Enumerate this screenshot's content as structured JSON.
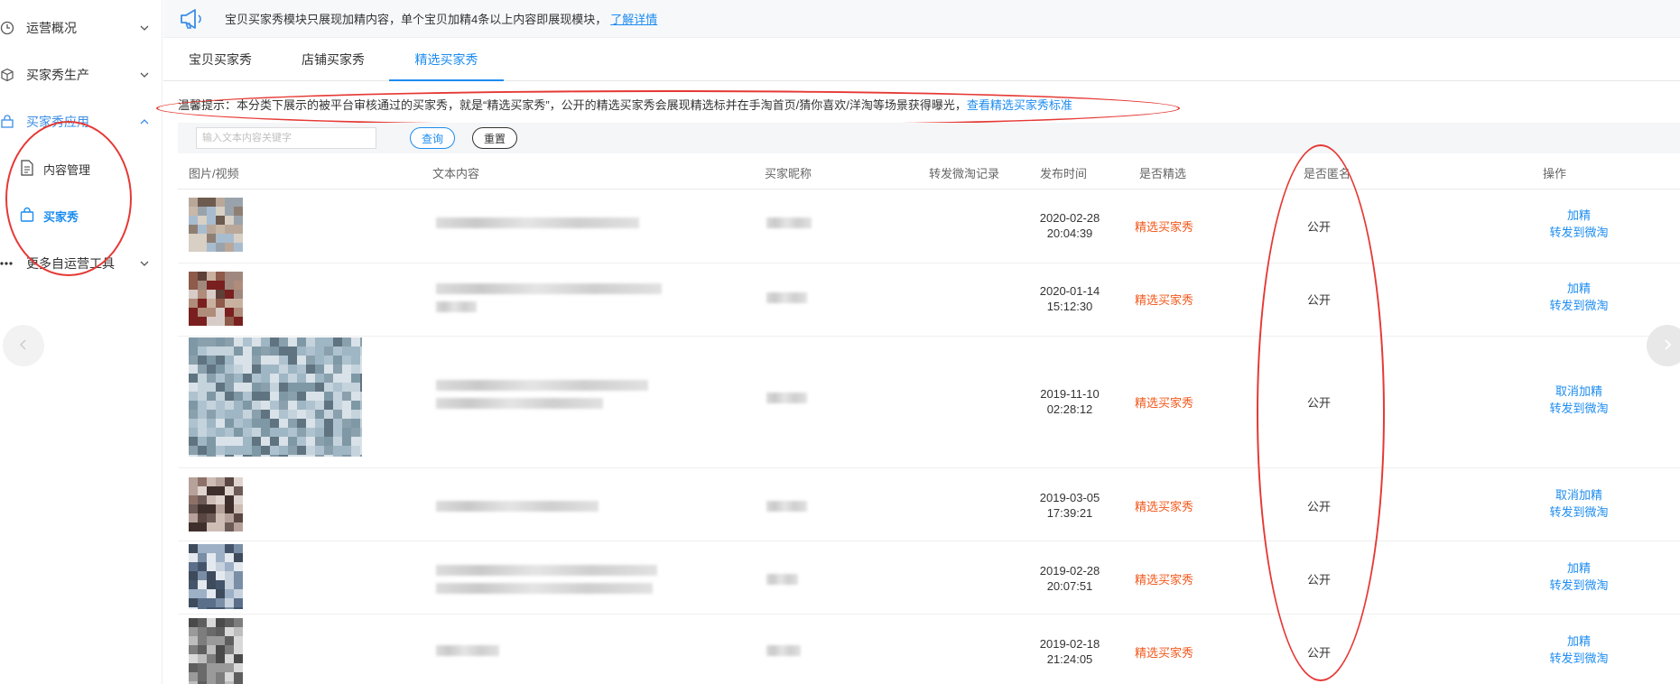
{
  "sidebar": {
    "groups": [
      {
        "label": "运营概况",
        "icon": "clock-icon"
      },
      {
        "label": "买家秀生产",
        "icon": "box-icon"
      },
      {
        "label": "买家秀应用",
        "icon": "shopping-icon"
      },
      {
        "label": "更多自运营工具",
        "icon": "more-dots-icon"
      }
    ],
    "subitems": [
      {
        "label": "内容管理",
        "icon": "document-icon"
      },
      {
        "label": "买家秀",
        "icon": "bag-icon"
      }
    ]
  },
  "notice": {
    "text": "宝贝买家秀模块只展现加精内容，单个宝贝加精4条以上内容即展现模块，",
    "link": "了解详情"
  },
  "tabs": [
    {
      "label": "宝贝买家秀"
    },
    {
      "label": "店铺买家秀"
    },
    {
      "label": "精选买家秀"
    }
  ],
  "tip": {
    "text": "温馨提示：本分类下展示的被平台审核通过的买家秀，就是“精选买家秀”，公开的精选买家秀会展现精选标并在手淘首页/猜你喜欢/洋淘等场景获得曝光，",
    "link": "查看精选买家秀标准"
  },
  "filter": {
    "placeholder": "输入文本内容关键字",
    "query_label": "查询",
    "reset_label": "重置"
  },
  "table": {
    "headers": [
      "图片/视频",
      "文本内容",
      "买家昵称",
      "转发微淘记录",
      "发布时间",
      "是否精选",
      "是否匿名",
      "操作"
    ],
    "rows": [
      {
        "date": "2020-02-28",
        "time": "20:04:39",
        "featured": "精选买家秀",
        "anon": "公开",
        "op1": "加精",
        "op2": "转发到微淘"
      },
      {
        "date": "2020-01-14",
        "time": "15:12:30",
        "featured": "精选买家秀",
        "anon": "公开",
        "op1": "加精",
        "op2": "转发到微淘"
      },
      {
        "date": "2019-11-10",
        "time": "02:28:12",
        "featured": "精选买家秀",
        "anon": "公开",
        "op1": "取消加精",
        "op2": "转发到微淘"
      },
      {
        "date": "2019-03-05",
        "time": "17:39:21",
        "featured": "精选买家秀",
        "anon": "公开",
        "op1": "取消加精",
        "op2": "转发到微淘"
      },
      {
        "date": "2019-02-28",
        "time": "20:07:51",
        "featured": "精选买家秀",
        "anon": "公开",
        "op1": "加精",
        "op2": "转发到微淘"
      },
      {
        "date": "2019-02-18",
        "time": "21:24:05",
        "featured": "精选买家秀",
        "anon": "公开",
        "op1": "加精",
        "op2": "转发到微淘"
      }
    ]
  },
  "colors": {
    "accent": "#1c8cf0",
    "featured": "#f2581c",
    "annotation": "#e53935"
  }
}
